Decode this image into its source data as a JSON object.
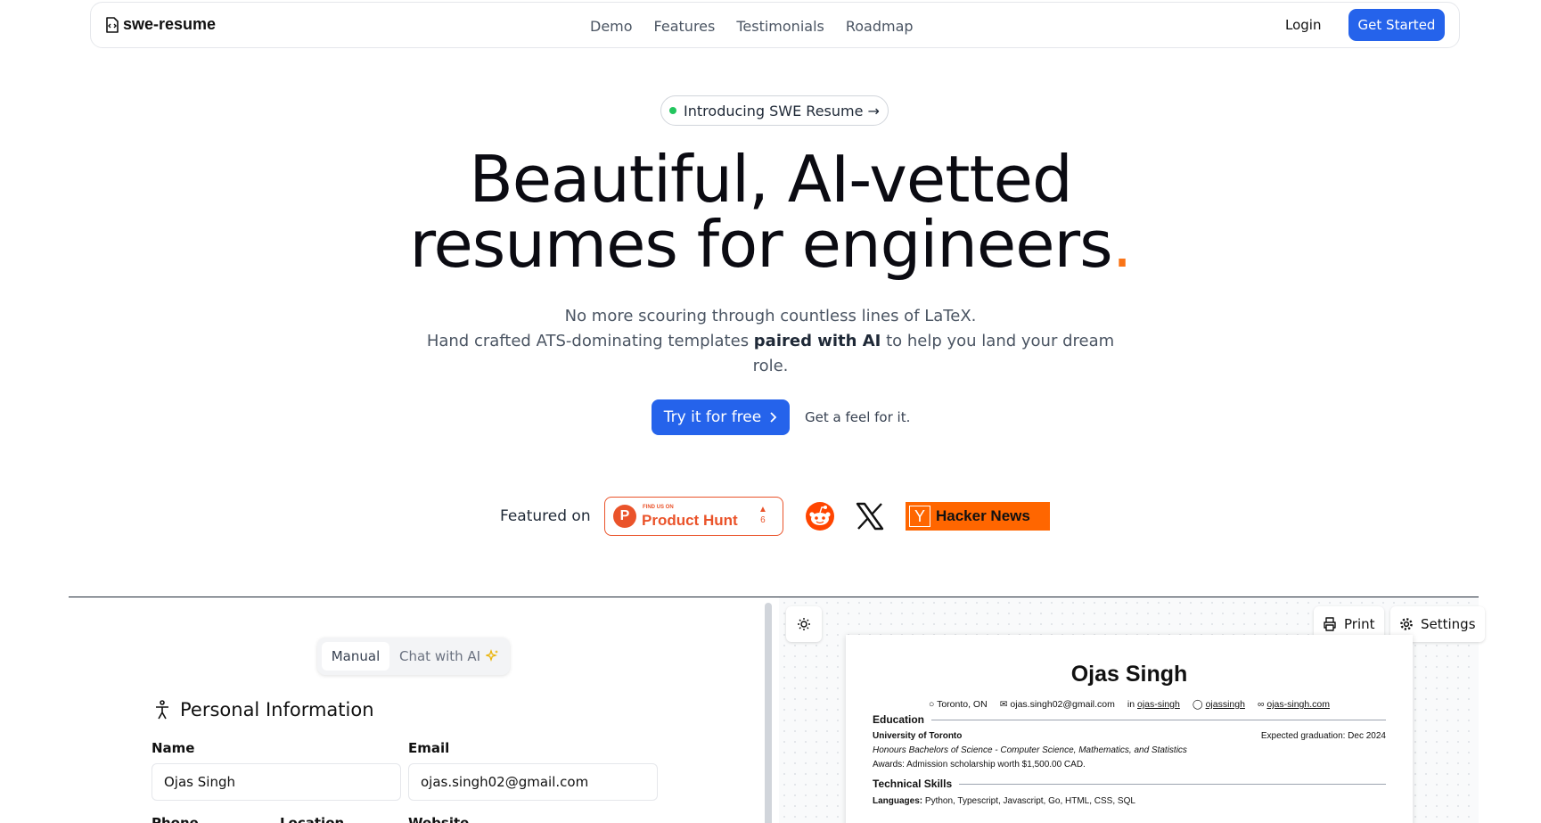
{
  "nav": {
    "brand": "swe-resume",
    "links": [
      "Demo",
      "Features",
      "Testimonials",
      "Roadmap"
    ],
    "login": "Login",
    "get_started": "Get Started"
  },
  "hero": {
    "badge": "Introducing SWE Resume →",
    "title_line1": "Beautiful, AI-vetted",
    "title_line2": "resumes for engineers",
    "title_dot": ".",
    "sub_line1": "No more scouring through countless lines of LaTeX.",
    "sub_line2_pre": "Hand crafted ATS-dominating templates ",
    "sub_line2_bold": "paired with AI",
    "sub_line2_post": " to help you land your dream",
    "sub_line3": "role.",
    "try_button": "Try it for free",
    "feel_text": "Get a feel for it."
  },
  "featured": {
    "label": "Featured on",
    "product_hunt_small": "FIND US ON",
    "product_hunt_big": "Product Hunt",
    "product_hunt_votes": "6",
    "hacker_news_y": "Y",
    "hacker_news_label": "Hacker News"
  },
  "editor": {
    "mode_manual": "Manual",
    "mode_ai": "Chat with AI",
    "section_title": "Personal Information",
    "name_label": "Name",
    "name_value": "Ojas Singh",
    "email_label": "Email",
    "email_value": "ojas.singh02@gmail.com",
    "phone_label": "Phone",
    "location_label": "Location",
    "website_label": "Website"
  },
  "preview": {
    "print_label": "Print",
    "settings_label": "Settings",
    "name": "Ojas Singh",
    "location": "Toronto, ON",
    "email": "ojas.singh02@gmail.com",
    "linkedin": "ojas-singh",
    "github": "ojassingh",
    "website": "ojas-singh.com",
    "education_title": "Education",
    "school": "University of Toronto",
    "graduation": "Expected graduation: Dec 2024",
    "degree": "Honours Bachelors of Science - Computer Science, Mathematics, and Statistics",
    "awards": "Awards: Admission scholarship worth $1,500.00 CAD.",
    "skills_title": "Technical Skills",
    "languages_label": "Languages:",
    "languages_value": " Python, Typescript, Javascript, Go, HTML, CSS, SQL"
  },
  "colors": {
    "primary": "#2563eb",
    "accent_orange": "#f97316",
    "product_hunt": "#ea532a",
    "hacker_news": "#ff6600",
    "reddit": "#ff4500"
  }
}
